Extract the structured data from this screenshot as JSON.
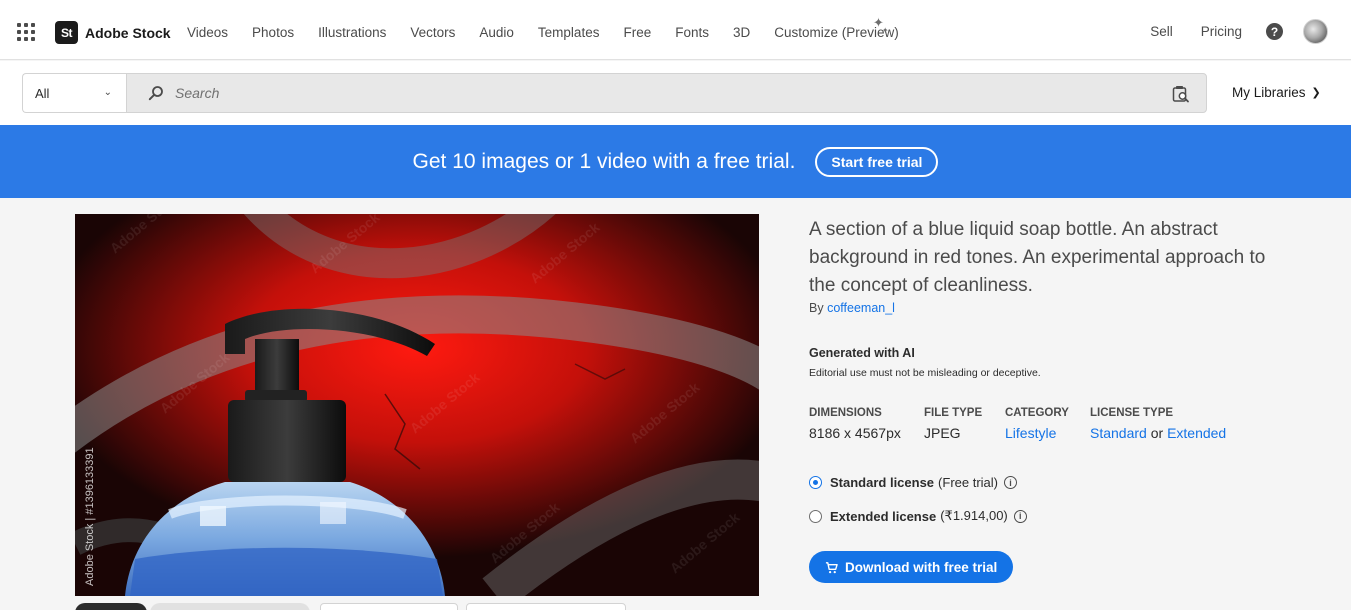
{
  "nav": {
    "brand_badge": "St",
    "brand": "Adobe Stock",
    "links": [
      "Videos",
      "Photos",
      "Illustrations",
      "Vectors",
      "Audio",
      "Templates",
      "Free",
      "Fonts",
      "3D",
      "Customize (Preview)"
    ],
    "right_links": [
      "Sell",
      "Pricing"
    ],
    "help": "?"
  },
  "search": {
    "filter_value": "All",
    "placeholder": "Search",
    "my_libraries": "My Libraries"
  },
  "banner": {
    "text": "Get 10 images or 1 video with a free trial.",
    "button": "Start free trial"
  },
  "preview": {
    "watermark_id": "Adobe Stock | #1396133391"
  },
  "asset": {
    "title": "A section of a blue liquid soap bottle. An abstract background in red tones. An experimental approach to the concept of cleanliness.",
    "by_prefix": "By",
    "author": "coffeeman_l",
    "ai_heading": "Generated with AI",
    "ai_note": "Editorial use must not be misleading or deceptive.",
    "meta": {
      "dimensions_label": "DIMENSIONS",
      "dimensions_value": "8186 x 4567px",
      "filetype_label": "FILE TYPE",
      "filetype_value": "JPEG",
      "category_label": "CATEGORY",
      "category_value": "Lifestyle",
      "license_label": "LICENSE TYPE",
      "license_standard": "Standard",
      "license_or": "or",
      "license_extended": "Extended"
    },
    "licenses": {
      "standard_name": "Standard license",
      "standard_detail": "(Free trial)",
      "extended_name": "Extended license",
      "extended_detail": "(₹1.914,00)",
      "selected": "standard"
    },
    "download_button": "Download with free trial"
  },
  "colors": {
    "accent": "#1473e6",
    "banner": "#2c7ae6"
  }
}
